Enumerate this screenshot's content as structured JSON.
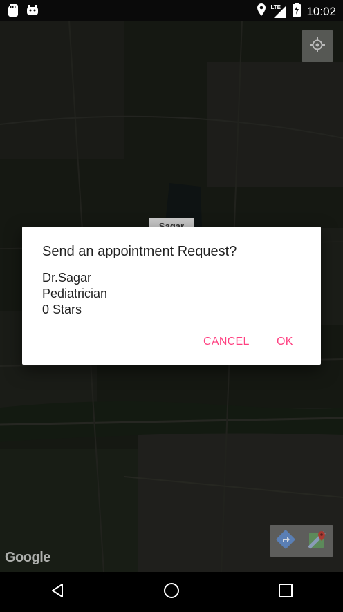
{
  "status_bar": {
    "time": "10:02",
    "network": "LTE",
    "icons": [
      "sd-card-icon",
      "android-icon",
      "location-icon",
      "signal-icon",
      "battery-charging-icon"
    ]
  },
  "map": {
    "marker_label": "Sagar",
    "attribution": "Google",
    "buttons": [
      "my-location-icon",
      "directions-icon",
      "google-maps-icon"
    ]
  },
  "dialog": {
    "title": "Send an appointment Request?",
    "lines": [
      "Dr.Sagar",
      "Pediatrician",
      "0 Stars"
    ],
    "cancel_label": "CANCEL",
    "ok_label": "OK",
    "accent_color": "#ff4081"
  },
  "nav_bar": {
    "buttons": [
      "back-icon",
      "home-icon",
      "recents-icon"
    ]
  }
}
